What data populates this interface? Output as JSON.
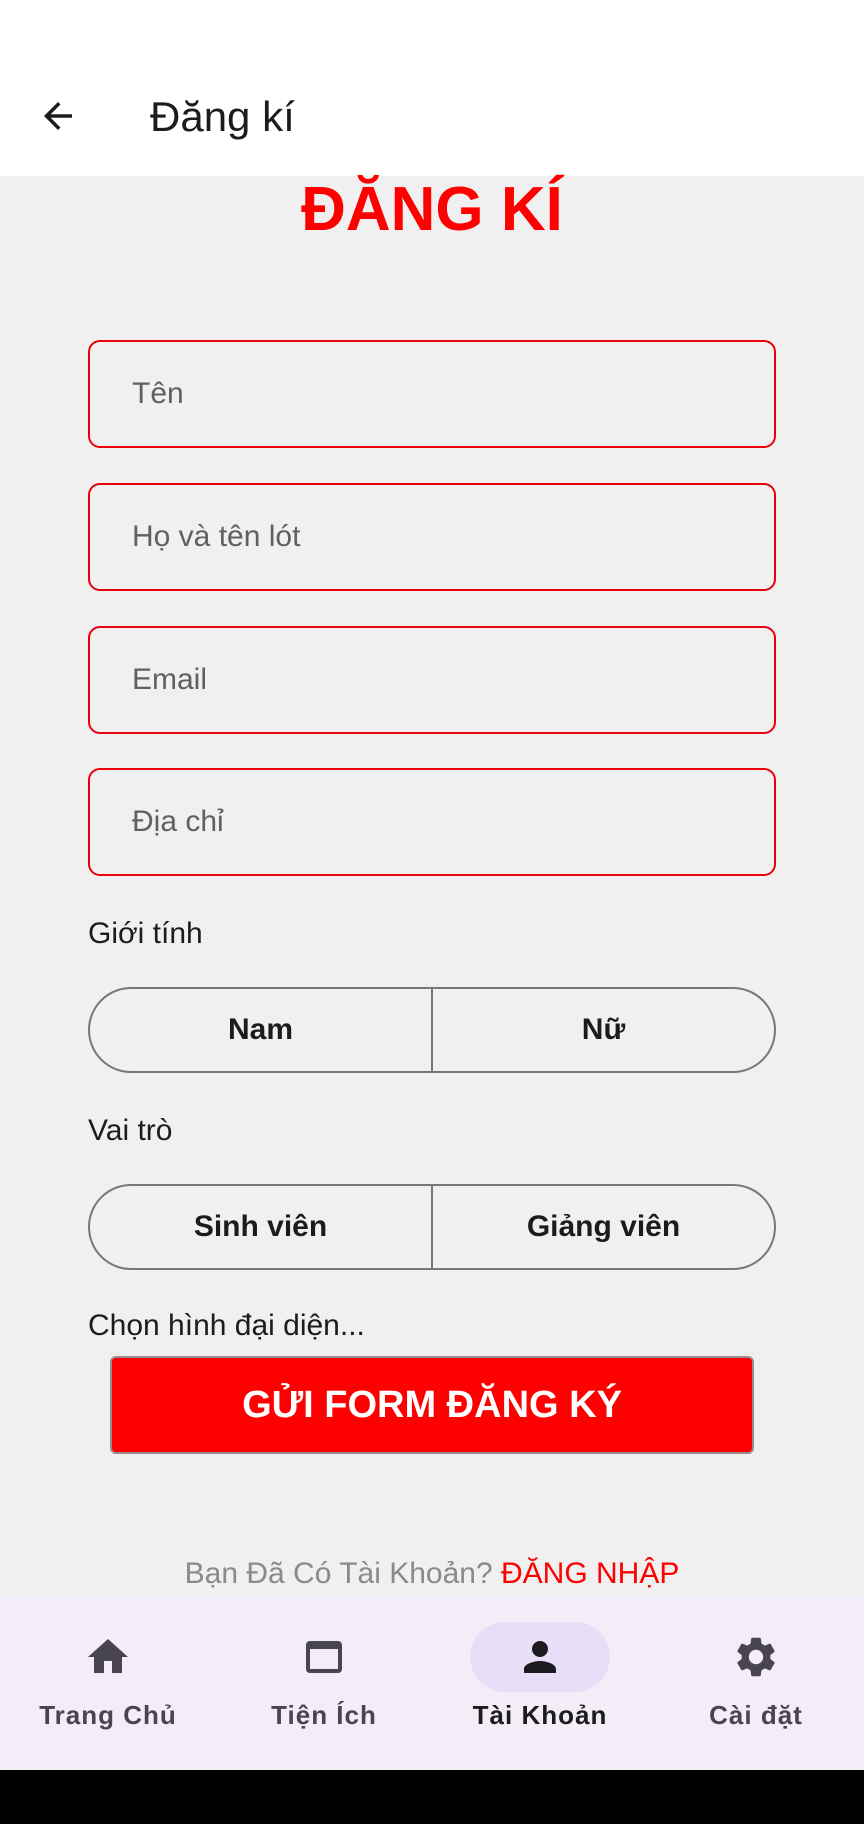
{
  "appbar": {
    "title": "Đăng kí"
  },
  "heading": "ĐĂNG KÍ",
  "form": {
    "first_name": {
      "placeholder": "Tên",
      "value": ""
    },
    "last_name": {
      "placeholder": "Họ và tên lót",
      "value": ""
    },
    "email": {
      "placeholder": "Email",
      "value": ""
    },
    "address": {
      "placeholder": "Địa chỉ",
      "value": ""
    },
    "gender": {
      "label": "Giới tính",
      "options": [
        "Nam",
        "Nữ"
      ]
    },
    "role": {
      "label": "Vai trò",
      "options": [
        "Sinh viên",
        "Giảng viên"
      ]
    },
    "avatar_label": "Chọn hình đại diện...",
    "submit_label": "GỬI FORM ĐĂNG KÝ"
  },
  "login": {
    "question": "Bạn Đã Có Tài Khoản?",
    "link": "ĐĂNG NHẬP"
  },
  "bottom_nav": {
    "items": [
      {
        "label": "Trang Chủ",
        "icon": "home-icon",
        "active": false
      },
      {
        "label": "Tiện Ích",
        "icon": "web-asset-icon",
        "active": false
      },
      {
        "label": "Tài Khoản",
        "icon": "person-icon",
        "active": true
      },
      {
        "label": "Cài đặt",
        "icon": "gear-icon",
        "active": false
      }
    ]
  },
  "colors": {
    "accent": "#ff0000",
    "field_border": "#e8000d",
    "nav_background": "#f3edf7",
    "nav_active_pill": "#e8def8"
  }
}
